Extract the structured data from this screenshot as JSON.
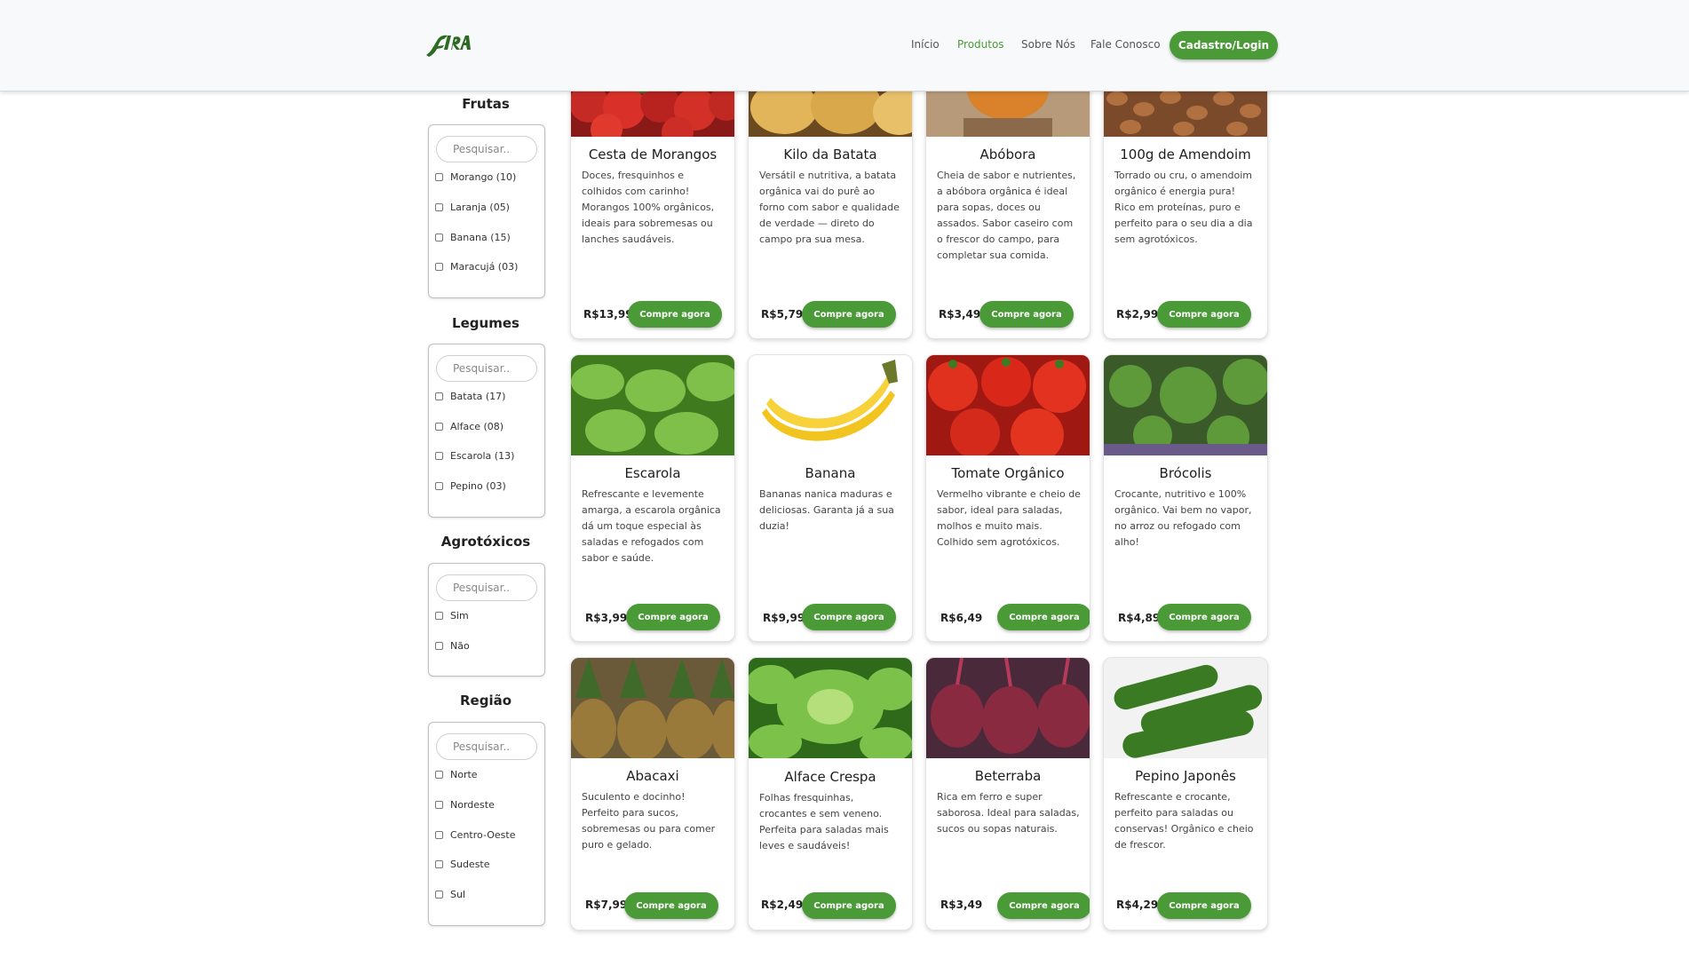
{
  "brand": {
    "logo_text": "FEIRA"
  },
  "nav": {
    "links": [
      "Início",
      "Produtos",
      "Sobre Nós",
      "Fale Conosco"
    ],
    "login_label": "Cadastro/Login"
  },
  "filters": [
    {
      "title": "Frutas",
      "placeholder": "Pesquisar..",
      "options": [
        "Morango (10)",
        "Laranja (05)",
        "Banana (15)",
        "Maracujá (03)"
      ]
    },
    {
      "title": "Legumes",
      "placeholder": "Pesquisar..",
      "options": [
        "Batata (17)",
        "Alface (08)",
        "Escarola (13)",
        "Pepino (03)"
      ]
    },
    {
      "title": "Agrotóxicos",
      "placeholder": "Pesquisar..",
      "options": [
        "Sim",
        "Não"
      ]
    },
    {
      "title": "Região",
      "placeholder": "Pesquisar..",
      "options": [
        "Norte",
        "Nordeste",
        "Centro-Oeste",
        "Sudeste",
        "Sul"
      ]
    }
  ],
  "buy_label": "Compre agora",
  "products": [
    {
      "title": "Cesta de Morangos",
      "description": "Doces, fresquinhos e colhidos com carinho! Morangos 100% orgânicos, ideais para sobremesas ou lanches saudáveis.",
      "price": "R$13,99",
      "image": "strawberry-image"
    },
    {
      "title": "Kilo da Batata",
      "description": "Versátil e nutritiva, a batata orgânica vai do purê ao forno com sabor e qualidade de verdade — direto do campo pra sua mesa.",
      "price": "R$5,79",
      "image": "potato-image"
    },
    {
      "title": "Abóbora",
      "description": "Cheia de sabor e nutrientes, a abóbora orgânica é ideal para sopas, doces ou assados. Sabor caseiro com o frescor do campo, para completar sua comida.",
      "price": "R$3,49",
      "image": "pumpkin-image"
    },
    {
      "title": "100g de Amendoim",
      "description": "Torrado ou cru, o amendoim orgânico é energia pura! Rico em proteínas, puro e perfeito para o seu dia a dia sem agrotóxicos.",
      "price": "R$2,99",
      "image": "peanut-image"
    },
    {
      "title": "Escarola",
      "description": "Refrescante e levemente amarga, a escarola orgânica dá um toque especial às saladas e refogados com sabor e saúde.",
      "price": "R$3,99",
      "image": "escarole-image"
    },
    {
      "title": "Banana",
      "description": "Bananas nanica maduras e deliciosas. Garanta já a sua duzia!",
      "price": "R$9,99",
      "image": "banana-image"
    },
    {
      "title": "Tomate Orgânico",
      "description": "Vermelho vibrante e cheio de sabor, ideal para saladas, molhos e muito mais. Colhido sem agrotóxicos.",
      "price": "R$6,49",
      "image": "tomato-image"
    },
    {
      "title": "Brócolis",
      "description": "Crocante, nutritivo e 100% orgânico. Vai bem no vapor, no arroz ou refogado com alho!",
      "price": "R$4,89",
      "image": "broccoli-image"
    },
    {
      "title": "Abacaxi",
      "description": "Suculento e docinho! Perfeito para sucos, sobremesas ou para comer puro e gelado.",
      "price": "R$7,99",
      "image": "pineapple-image"
    },
    {
      "title": "Alface Crespa",
      "description": "Folhas fresquinhas, crocantes e sem veneno. Perfeita para saladas mais leves e saudáveis!",
      "price": "R$2,49",
      "image": "lettuce-image"
    },
    {
      "title": "Beterraba",
      "description": "Rica em ferro e super saborosa. Ideal para saladas, sucos ou sopas naturais.",
      "price": "R$3,49",
      "image": "beet-image"
    },
    {
      "title": "Pepino Japonês",
      "description": "Refrescante e crocante, perfeito para saladas ou conservas! Orgânico e cheio de frescor.",
      "price": "R$4,29",
      "image": "cucumber-image"
    }
  ],
  "colors": {
    "accent": "#4a9a37",
    "navbar_bg": "#f8f9fa"
  }
}
